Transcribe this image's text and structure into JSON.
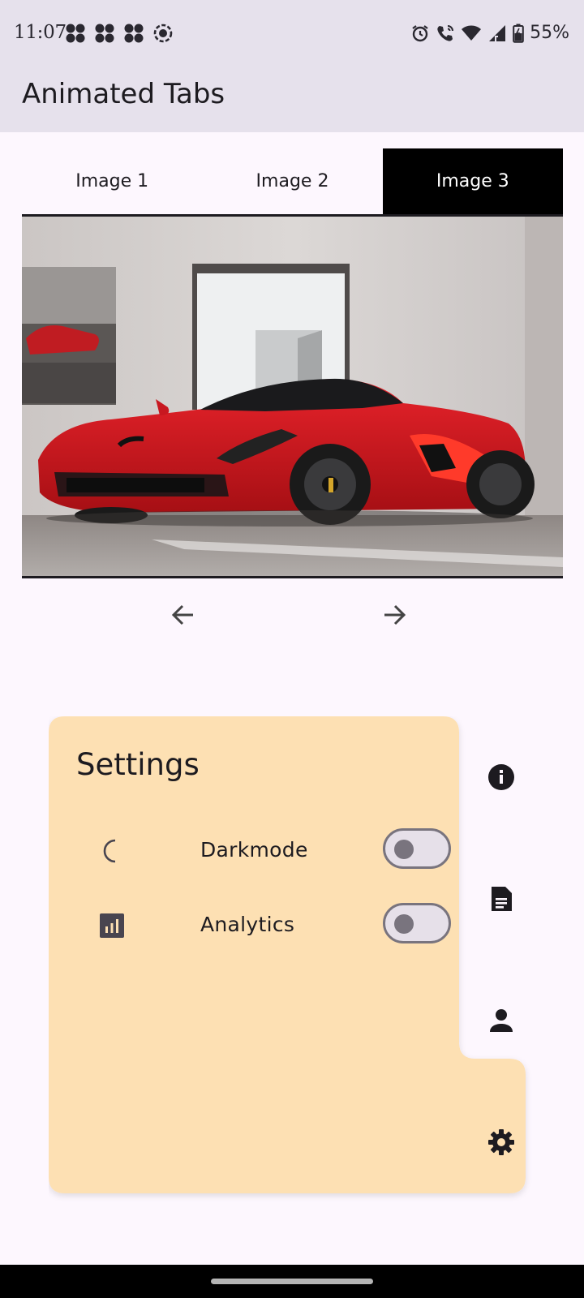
{
  "status_bar": {
    "time": "11:07",
    "battery": "55%",
    "left_icons": [
      "fan-icon",
      "fan-icon",
      "fan-icon",
      "target-icon"
    ],
    "right_icons": [
      "alarm-icon",
      "wifi-calling-icon",
      "wifi-icon",
      "signal-icon",
      "battery-charging-icon"
    ]
  },
  "app_bar": {
    "title": "Animated Tabs"
  },
  "tabs": [
    {
      "label": "Image 1",
      "active": false
    },
    {
      "label": "Image 2",
      "active": false
    },
    {
      "label": "Image 3",
      "active": true
    }
  ],
  "image": {
    "description_icon": "car-photo"
  },
  "navigation": {
    "prev_icon": "arrow-left-icon",
    "next_icon": "arrow-right-icon"
  },
  "settings": {
    "title": "Settings",
    "items": [
      {
        "label": "Darkmode",
        "icon": "moon-icon",
        "enabled": false
      },
      {
        "label": "Analytics",
        "icon": "analytics-icon",
        "enabled": false
      }
    ],
    "side_icons": [
      "info-icon",
      "document-icon",
      "person-icon",
      "gear-icon"
    ],
    "panel_color": "#fde0b3"
  }
}
